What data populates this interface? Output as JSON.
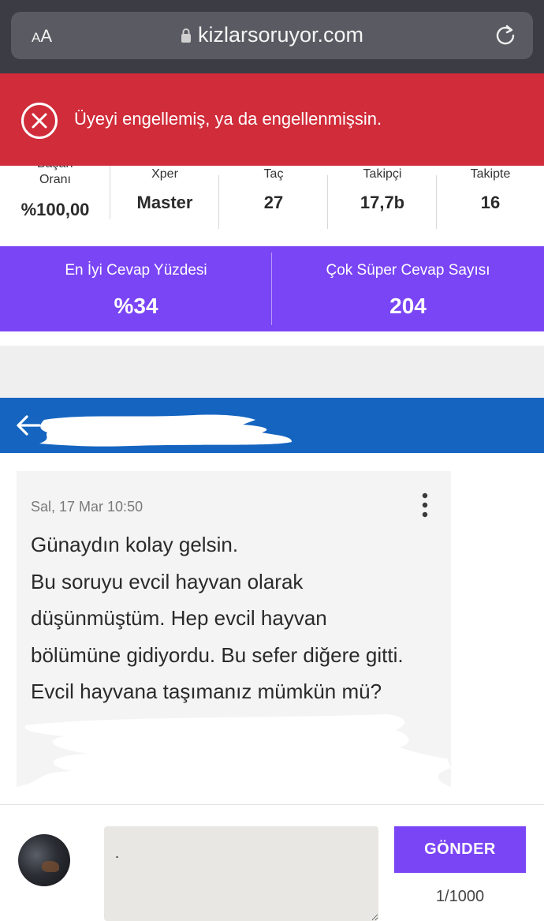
{
  "browser": {
    "text_size_label_small": "A",
    "text_size_label_large": "A",
    "url": "kizlarsoruyor.com"
  },
  "error_banner": {
    "message": "Üyeyi engellemiş, ya da engellenmişsin.",
    "color": "#d12c3a"
  },
  "stats": [
    {
      "label": "Başarı Oranı",
      "value": "%100,00"
    },
    {
      "label": "Xper",
      "value": "Master"
    },
    {
      "label": "Taç",
      "value": "27"
    },
    {
      "label": "Takipçi",
      "value": "17,7b"
    },
    {
      "label": "Takipte",
      "value": "16"
    }
  ],
  "highlights": [
    {
      "label": "En İyi Cevap Yüzdesi",
      "value": "%34"
    },
    {
      "label": "Çok Süper Cevap Sayısı",
      "value": "204"
    }
  ],
  "accent_color": "#7a45f5",
  "header_color": "#1565c0",
  "message": {
    "date": "Sal, 17 Mar 10:50",
    "lines": [
      "Günaydın kolay gelsin.",
      "Bu soruyu evcil hayvan olarak",
      "düşünmüştüm. Hep evcil hayvan",
      "bölümüne gidiyordu. Bu sefer diğere gitti.",
      "Evcil hayvana taşımanız mümkün mü?"
    ]
  },
  "composer": {
    "input_value": ".",
    "send_label": "GÖNDER",
    "char_count": "1/1000"
  },
  "icons": {
    "lock": "lock-icon",
    "reload": "reload-icon",
    "error": "error-circle-x-icon",
    "back": "arrow-left-icon",
    "more": "more-vertical-icon"
  }
}
